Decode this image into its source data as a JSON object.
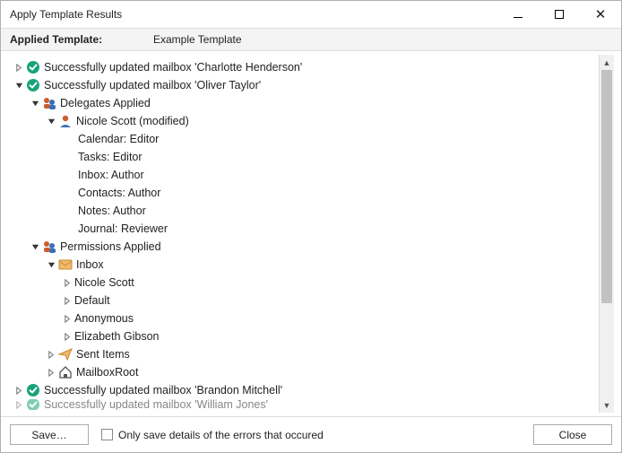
{
  "window": {
    "title": "Apply Template Results"
  },
  "header": {
    "label": "Applied Template:",
    "value": "Example Template"
  },
  "tree": {
    "r0": "Successfully updated mailbox 'Charlotte Henderson'",
    "r1": "Successfully updated mailbox 'Oliver Taylor'",
    "r2": "Delegates Applied",
    "r3": "Nicole Scott (modified)",
    "r4": "Calendar: Editor",
    "r5": "Tasks: Editor",
    "r6": "Inbox: Author",
    "r7": "Contacts: Author",
    "r8": "Notes: Author",
    "r9": "Journal: Reviewer",
    "r10": "Permissions Applied",
    "r11": "Inbox",
    "r12": "Nicole Scott",
    "r13": "Default",
    "r14": "Anonymous",
    "r15": "Elizabeth Gibson",
    "r16": "Sent Items",
    "r17": "MailboxRoot",
    "r18": "Successfully updated mailbox 'Brandon Mitchell'",
    "r19": "Successfully updated mailbox 'William Jones'"
  },
  "footer": {
    "save": "Save…",
    "only_errors": "Only save details of the errors that occured",
    "close": "Close"
  }
}
